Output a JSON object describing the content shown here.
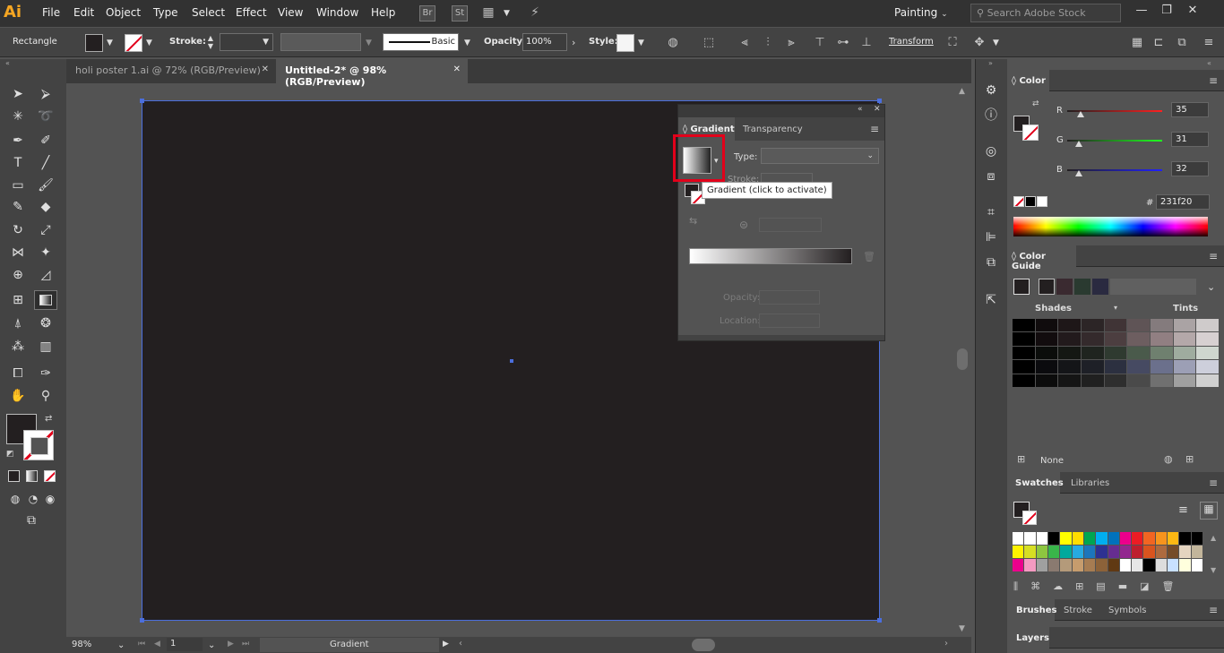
{
  "app": {
    "logo": "Ai"
  },
  "menu": [
    "File",
    "Edit",
    "Object",
    "Type",
    "Select",
    "Effect",
    "View",
    "Window",
    "Help"
  ],
  "menubar_icons": {
    "bridge": "Br",
    "stock": "St"
  },
  "workspace": "Painting",
  "search_placeholder": "Search Adobe Stock",
  "window_buttons": {
    "minimize": "—",
    "restore": "❐",
    "close": "✕"
  },
  "control": {
    "selection": "Rectangle",
    "stroke_label": "Stroke:",
    "brush": "Basic",
    "opacity_label": "Opacity:",
    "opacity_value": "100%",
    "style_label": "Style:",
    "transform": "Transform"
  },
  "tabs": [
    {
      "label": "holi poster 1.ai @ 72% (RGB/Preview)",
      "close": "✕",
      "active": false
    },
    {
      "label": "Untitled-2* @ 98% (RGB/Preview)",
      "close": "✕",
      "active": true
    }
  ],
  "gradient_panel": {
    "tabs": [
      "Gradient",
      "Transparency"
    ],
    "type_label": "Type:",
    "stroke_label": "Stroke:",
    "opacity_label": "Opacity:",
    "location_label": "Location:",
    "tooltip": "Gradient (click to activate)"
  },
  "color_panel": {
    "title": "Color",
    "r_label": "R",
    "g_label": "G",
    "b_label": "B",
    "r": "35",
    "g": "31",
    "b": "32",
    "hex_label": "#",
    "hex": "231f20",
    "r_fraction": 0.137,
    "g_fraction": 0.122,
    "b_fraction": 0.125
  },
  "color_guide": {
    "title": "Color Guide",
    "shades": "Shades",
    "tints": "Tints",
    "none": "None"
  },
  "swatches": {
    "tabs": [
      "Swatches",
      "Libraries"
    ]
  },
  "brushes_tabs": [
    "Brushes",
    "Stroke",
    "Symbols"
  ],
  "layers": "Layers",
  "status": {
    "zoom": "98%",
    "page": "1",
    "tool": "Gradient"
  },
  "colors": {
    "fill": "#231f20",
    "accent": "#e2001a",
    "selection": "#4b6edc"
  }
}
